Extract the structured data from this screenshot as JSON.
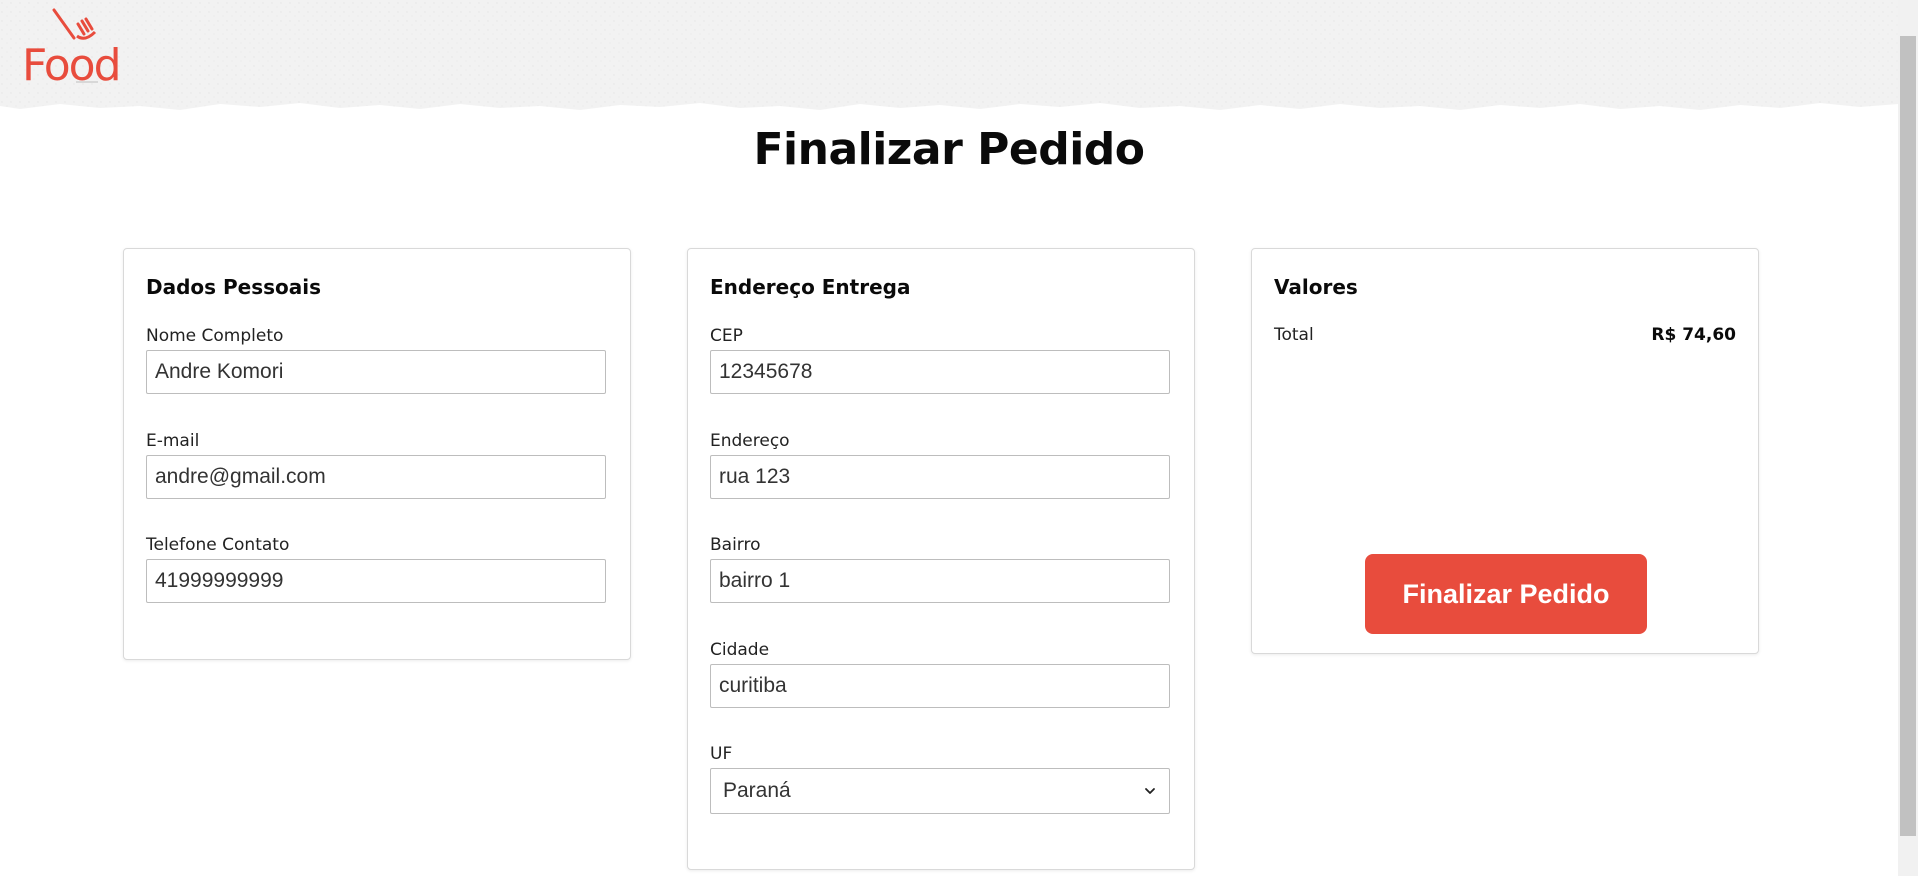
{
  "brand": {
    "name": "Food",
    "color": "#e84c3d"
  },
  "page_title": "Finalizar Pedido",
  "personal": {
    "title": "Dados Pessoais",
    "name_label": "Nome Completo",
    "name_value": "Andre Komori",
    "email_label": "E-mail",
    "email_value": "andre@gmail.com",
    "phone_label": "Telefone Contato",
    "phone_value": "41999999999"
  },
  "address": {
    "title": "Endereço Entrega",
    "cep_label": "CEP",
    "cep_value": "12345678",
    "street_label": "Endereço",
    "street_value": "rua 123",
    "district_label": "Bairro",
    "district_value": "bairro 1",
    "city_label": "Cidade",
    "city_value": "curitiba",
    "uf_label": "UF",
    "uf_selected": "Paraná"
  },
  "values": {
    "title": "Valores",
    "total_label": "Total",
    "total_value": "R$ 74,60",
    "submit_label": "Finalizar Pedido"
  },
  "icons": {
    "logo": "fork-logo-icon",
    "select_arrow": "chevron-down-icon"
  }
}
